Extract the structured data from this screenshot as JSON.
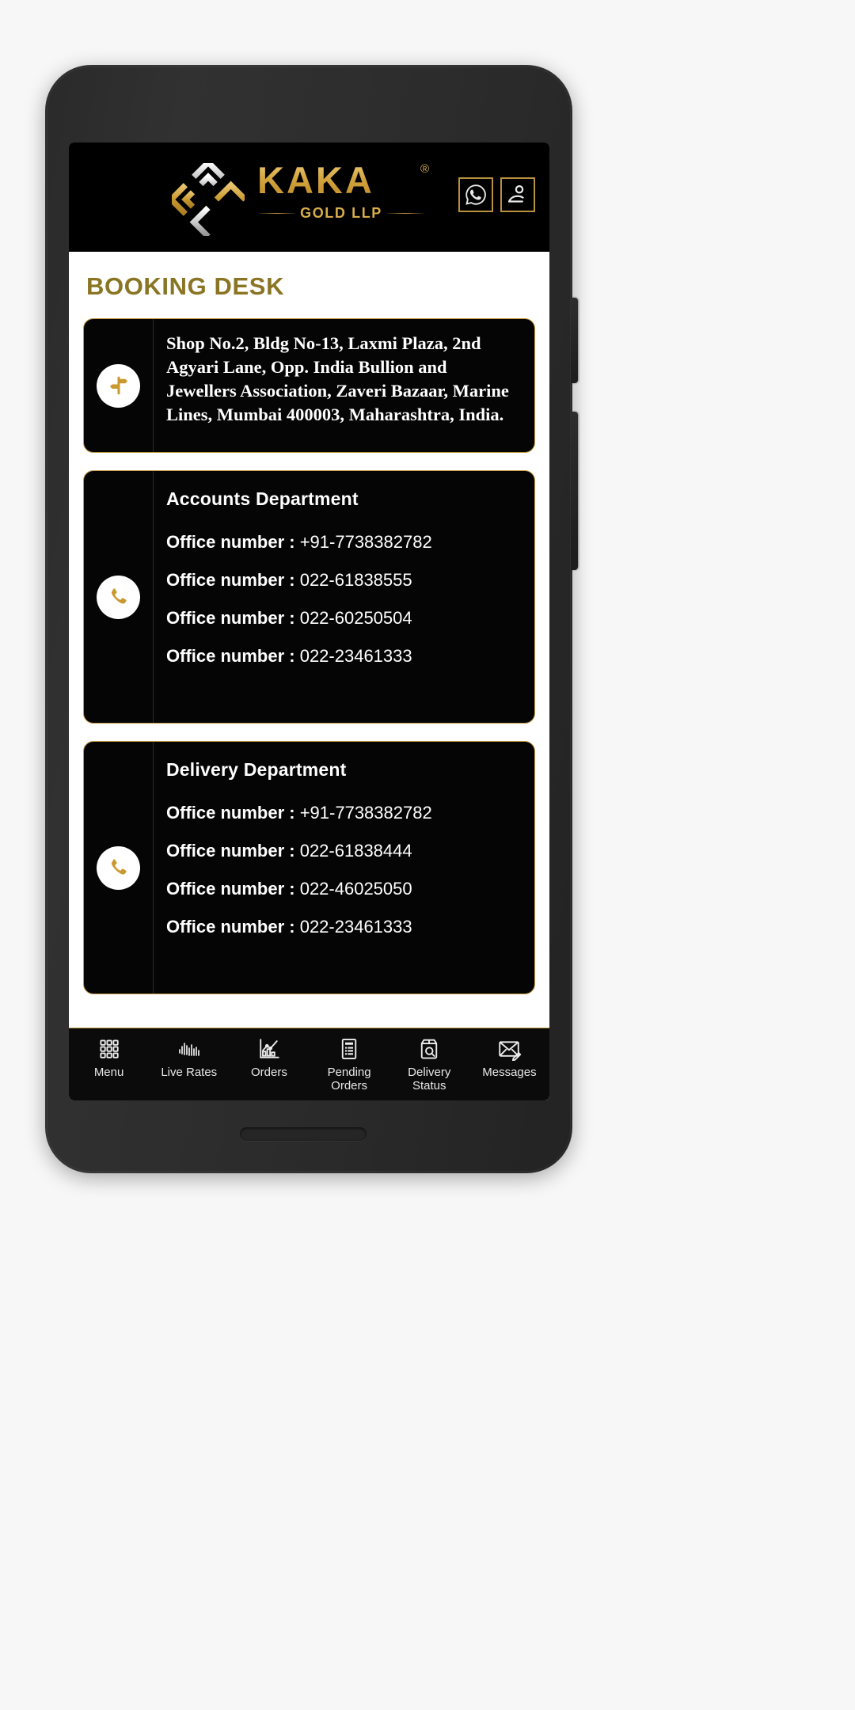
{
  "brand": {
    "name": "KAKA",
    "registered_mark": "®",
    "tagline": "GOLD LLP",
    "logo_icon": "kaka-interlocking-diamond-logo",
    "gold_color": "#d4a63f",
    "gold_light": "#f0cf7c"
  },
  "header": {
    "actions": [
      {
        "name": "whatsapp-button",
        "icon": "whatsapp-icon"
      },
      {
        "name": "profile-button",
        "icon": "user-account-icon"
      }
    ]
  },
  "page": {
    "title": "BOOKING DESK",
    "title_color": "#8a7524"
  },
  "cards": {
    "address": {
      "icon": "directions-signpost-icon",
      "text": "Shop No.2, Bldg No-13, Laxmi Plaza, 2nd Agyari Lane, Opp. India Bullion and Jewellers Association, Zaveri Bazaar, Marine Lines, Mumbai 400003, Maharashtra, India."
    },
    "accounts": {
      "icon": "phone-call-icon",
      "title": "Accounts Department",
      "lines": [
        {
          "label": "Office number :",
          "value": "+91-7738382782"
        },
        {
          "label": "Office number :",
          "value": "022-61838555"
        },
        {
          "label": "Office number :",
          "value": "022-60250504"
        },
        {
          "label": "Office number :",
          "value": "022-23461333"
        }
      ]
    },
    "delivery": {
      "icon": "phone-call-icon",
      "title": "Delivery Department",
      "lines": [
        {
          "label": "Office number :",
          "value": "+91-7738382782"
        },
        {
          "label": "Office number :",
          "value": "022-61838444"
        },
        {
          "label": "Office number :",
          "value": "022-46025050"
        },
        {
          "label": "Office number :",
          "value": "022-23461333"
        }
      ]
    }
  },
  "bottom_nav": {
    "items": [
      {
        "name": "nav-menu",
        "icon": "grid-menu-icon",
        "label": "Menu"
      },
      {
        "name": "nav-live-rates",
        "icon": "waveform-icon",
        "label": "Live Rates"
      },
      {
        "name": "nav-orders",
        "icon": "bar-chart-icon",
        "label": "Orders"
      },
      {
        "name": "nav-pending-orders",
        "icon": "document-list-icon",
        "label": "Pending\nOrders"
      },
      {
        "name": "nav-delivery-status",
        "icon": "package-search-icon",
        "label": "Delivery\nStatus"
      },
      {
        "name": "nav-messages",
        "icon": "envelope-edit-icon",
        "label": "Messages"
      }
    ]
  }
}
